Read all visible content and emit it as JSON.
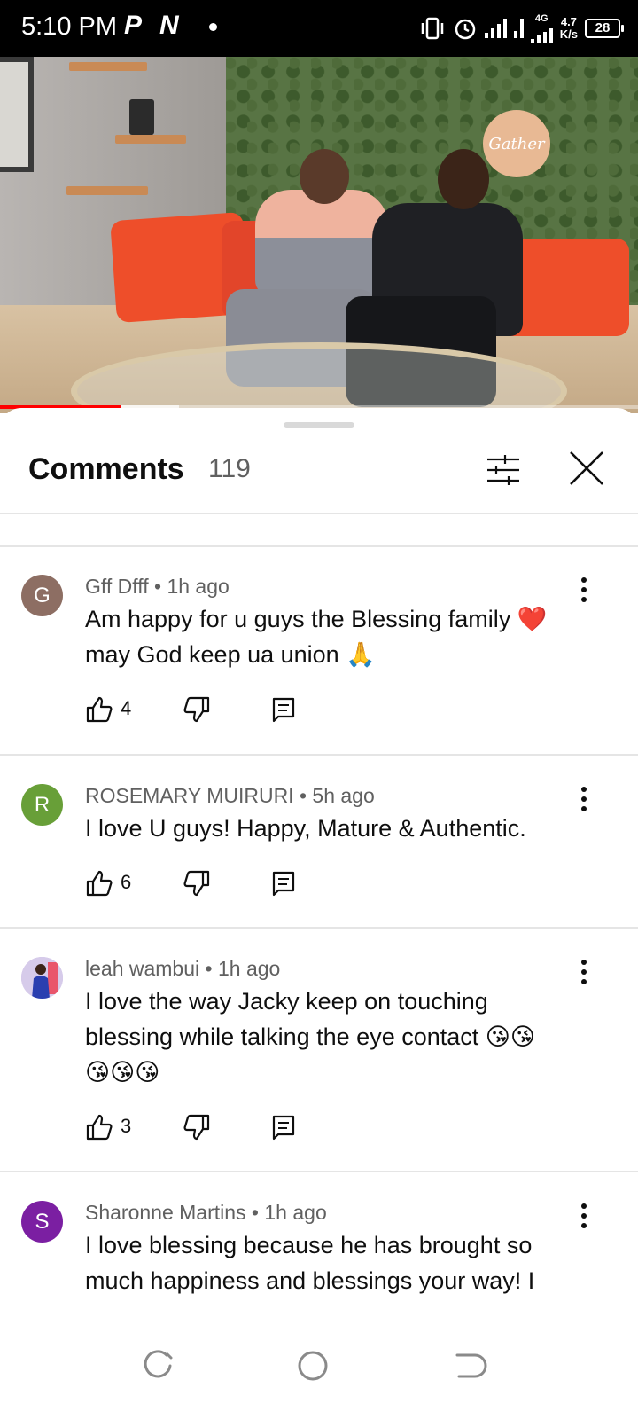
{
  "status_bar": {
    "time": "5:10 PM",
    "app_icon_1": "P",
    "app_icon_2": "N",
    "network_type": "4G",
    "speed_value": "4.7",
    "speed_unit": "K/s",
    "battery": "28"
  },
  "video": {
    "sign_text": "Gather",
    "progress": 0.19,
    "buffered": 0.28,
    "colors": {
      "progress": "#ff0000"
    }
  },
  "comments_panel": {
    "title": "Comments",
    "count": "119",
    "filter_icon": "sliders-icon",
    "close_icon": "close-icon",
    "comments": [
      {
        "avatar_letter": "G",
        "avatar_color": "#8d6e63",
        "author": "Gff Dfff",
        "time": "1h ago",
        "text_line1": "Am happy for u guys the Blessing family ❤️",
        "text_line2": "may God keep ua union 🙏",
        "likes": "4"
      },
      {
        "avatar_letter": "R",
        "avatar_color": "#689f38",
        "author": "ROSEMARY MUIRURI",
        "time": "5h ago",
        "text_line1": "I love U guys! Happy, Mature & Authentic.",
        "likes": "6"
      },
      {
        "avatar_letter": "",
        "avatar_color": "#c8b8e8",
        "author": "leah wambui",
        "time": "1h ago",
        "text_line1": "I love the way Jacky keep on touching",
        "text_line2": "blessing while talking the eye contact 😘😘",
        "text_line3": "😘😘😘",
        "likes": "3"
      },
      {
        "avatar_letter": "S",
        "avatar_color": "#7b1fa2",
        "author": "Sharonne Martins",
        "time": "1h ago",
        "text_line1": "I love blessing because he has brought so",
        "text_line2": "much happiness and blessings your way! I"
      }
    ]
  },
  "nav_bar": {
    "recents_icon": "recents-icon",
    "home_icon": "home-icon",
    "back_icon": "back-icon"
  }
}
